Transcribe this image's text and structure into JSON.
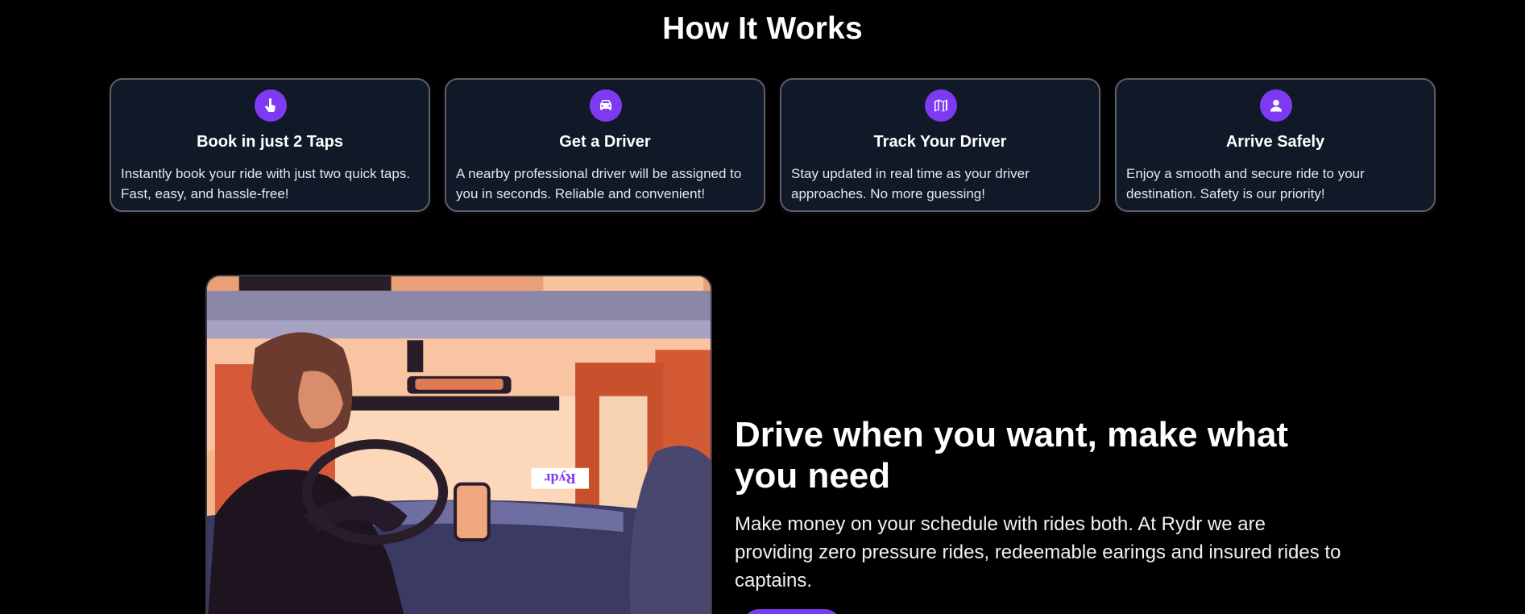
{
  "how_it_works": {
    "title": "How It Works",
    "steps": [
      {
        "icon": "tap-hand-icon",
        "title": "Book in just 2 Taps",
        "description": "Instantly book your ride with just two quick taps. Fast, easy, and hassle-free!"
      },
      {
        "icon": "car-icon",
        "title": "Get a Driver",
        "description": "A nearby professional driver will be assigned to you in seconds. Reliable and convenient!"
      },
      {
        "icon": "map-icon",
        "title": "Track Your Driver",
        "description": "Stay updated in real time as your driver approaches. No more guessing!"
      },
      {
        "icon": "user-icon",
        "title": "Arrive Safely",
        "description": "Enjoy a smooth and secure ride to your destination. Safety is our priority!"
      }
    ]
  },
  "drive": {
    "title": "Drive when you want, make what you need",
    "description": "Make money on your schedule with rides both. At Rydr we are providing zero pressure rides, redeemable earings and insured rides to captains.",
    "illustration_sign": "Rydr"
  },
  "colors": {
    "accent": "#7e3af2",
    "card_bg": "#111827",
    "page_bg": "#000000"
  }
}
